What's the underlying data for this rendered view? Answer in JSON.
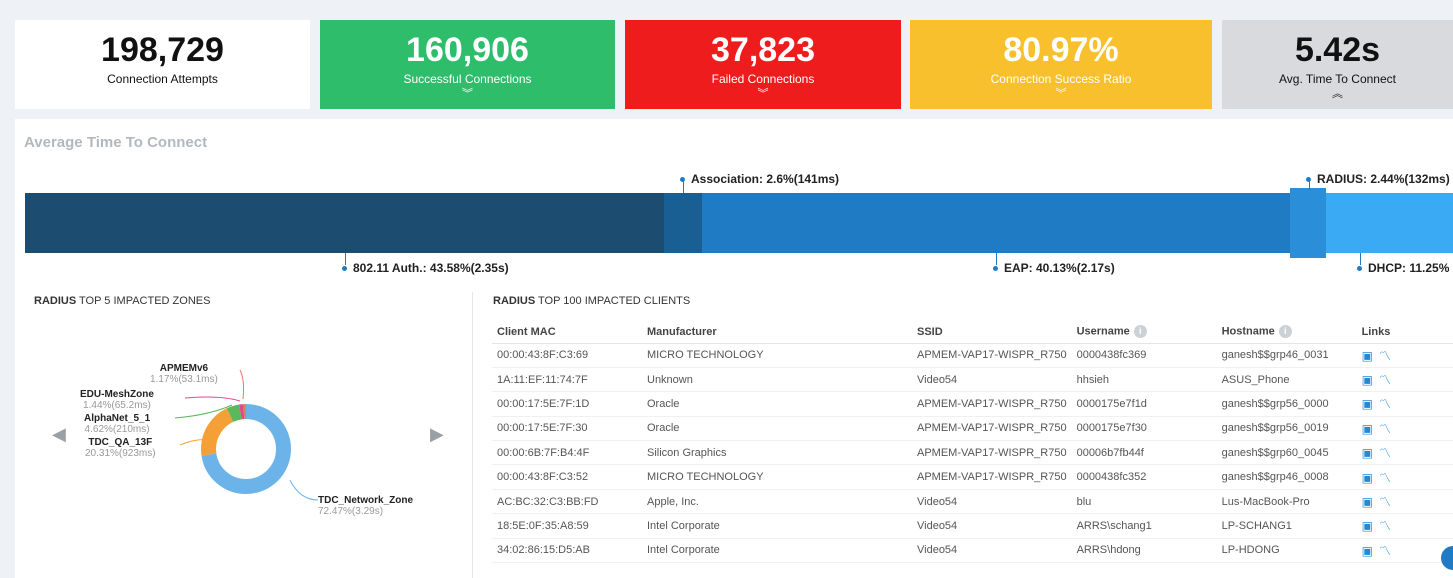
{
  "kpis": [
    {
      "value": "198,729",
      "label": "Connection Attempts"
    },
    {
      "value": "160,906",
      "label": "Successful Connections",
      "chevron": "︾"
    },
    {
      "value": "37,823",
      "label": "Failed Connections",
      "chevron": "︾"
    },
    {
      "value": "80.97%",
      "label": "Connection Success Ratio",
      "chevron": "︾"
    },
    {
      "value": "5.42s",
      "label": "Avg. Time To Connect",
      "chevron": "︽"
    }
  ],
  "avg_section": {
    "title": "Average Time To Connect",
    "callouts": {
      "association": "Association: 2.6%(141ms)",
      "radius": "RADIUS: 2.44%(132ms)",
      "auth": "802.11 Auth.: 43.58%(2.35s)",
      "eap": "EAP: 40.13%(2.17s)",
      "dhcp": "DHCP: 11.25%"
    }
  },
  "zones": {
    "title_bold": "RADIUS",
    "title_rest": " TOP 5 IMPACTED ZONES",
    "items": [
      {
        "name": "APMEMv6",
        "pct": "1.17%(53.1ms)",
        "color": "#e07b6a"
      },
      {
        "name": "EDU-MeshZone",
        "pct": "1.44%(65.2ms)",
        "color": "#e8468a"
      },
      {
        "name": "AlphaNet_5_1",
        "pct": "4.62%(210ms)",
        "color": "#5cb85c"
      },
      {
        "name": "TDC_QA_13F",
        "pct": "20.31%(923ms)",
        "color": "#f5a037"
      },
      {
        "name": "TDC_Network_Zone",
        "pct": "72.47%(3.29s)",
        "color": "#6bb3e8"
      }
    ]
  },
  "clients": {
    "title_bold": "RADIUS",
    "title_rest": " TOP 100 IMPACTED CLIENTS",
    "headers": [
      "Client MAC",
      "Manufacturer",
      "SSID",
      "Username",
      "Hostname",
      "Links"
    ],
    "rows": [
      [
        "00:00:43:8F:C3:69",
        "MICRO TECHNOLOGY",
        "APMEM-VAP17-WISPR_R750",
        "0000438fc369",
        "ganesh$$grp46_0031"
      ],
      [
        "1A:11:EF:11:74:7F",
        "Unknown",
        "Video54",
        "hhsieh",
        "ASUS_Phone"
      ],
      [
        "00:00:17:5E:7F:1D",
        "Oracle",
        "APMEM-VAP17-WISPR_R750",
        "0000175e7f1d",
        "ganesh$$grp56_0000"
      ],
      [
        "00:00:17:5E:7F:30",
        "Oracle",
        "APMEM-VAP17-WISPR_R750",
        "0000175e7f30",
        "ganesh$$grp56_0019"
      ],
      [
        "00:00:6B:7F:B4:4F",
        "Silicon Graphics",
        "APMEM-VAP17-WISPR_R750",
        "00006b7fb44f",
        "ganesh$$grp60_0045"
      ],
      [
        "00:00:43:8F:C3:52",
        "MICRO TECHNOLOGY",
        "APMEM-VAP17-WISPR_R750",
        "0000438fc352",
        "ganesh$$grp46_0008"
      ],
      [
        "AC:BC:32:C3:BB:FD",
        "Apple, Inc.",
        "Video54",
        "blu",
        "Lus-MacBook-Pro"
      ],
      [
        "18:5E:0F:35:A8:59",
        "Intel Corporate",
        "Video54",
        "ARRS\\schang1",
        "LP-SCHANG1"
      ],
      [
        "34:02:86:15:D5:AB",
        "Intel Corporate",
        "Video54",
        "ARRS\\hdong",
        "LP-HDONG"
      ]
    ]
  }
}
